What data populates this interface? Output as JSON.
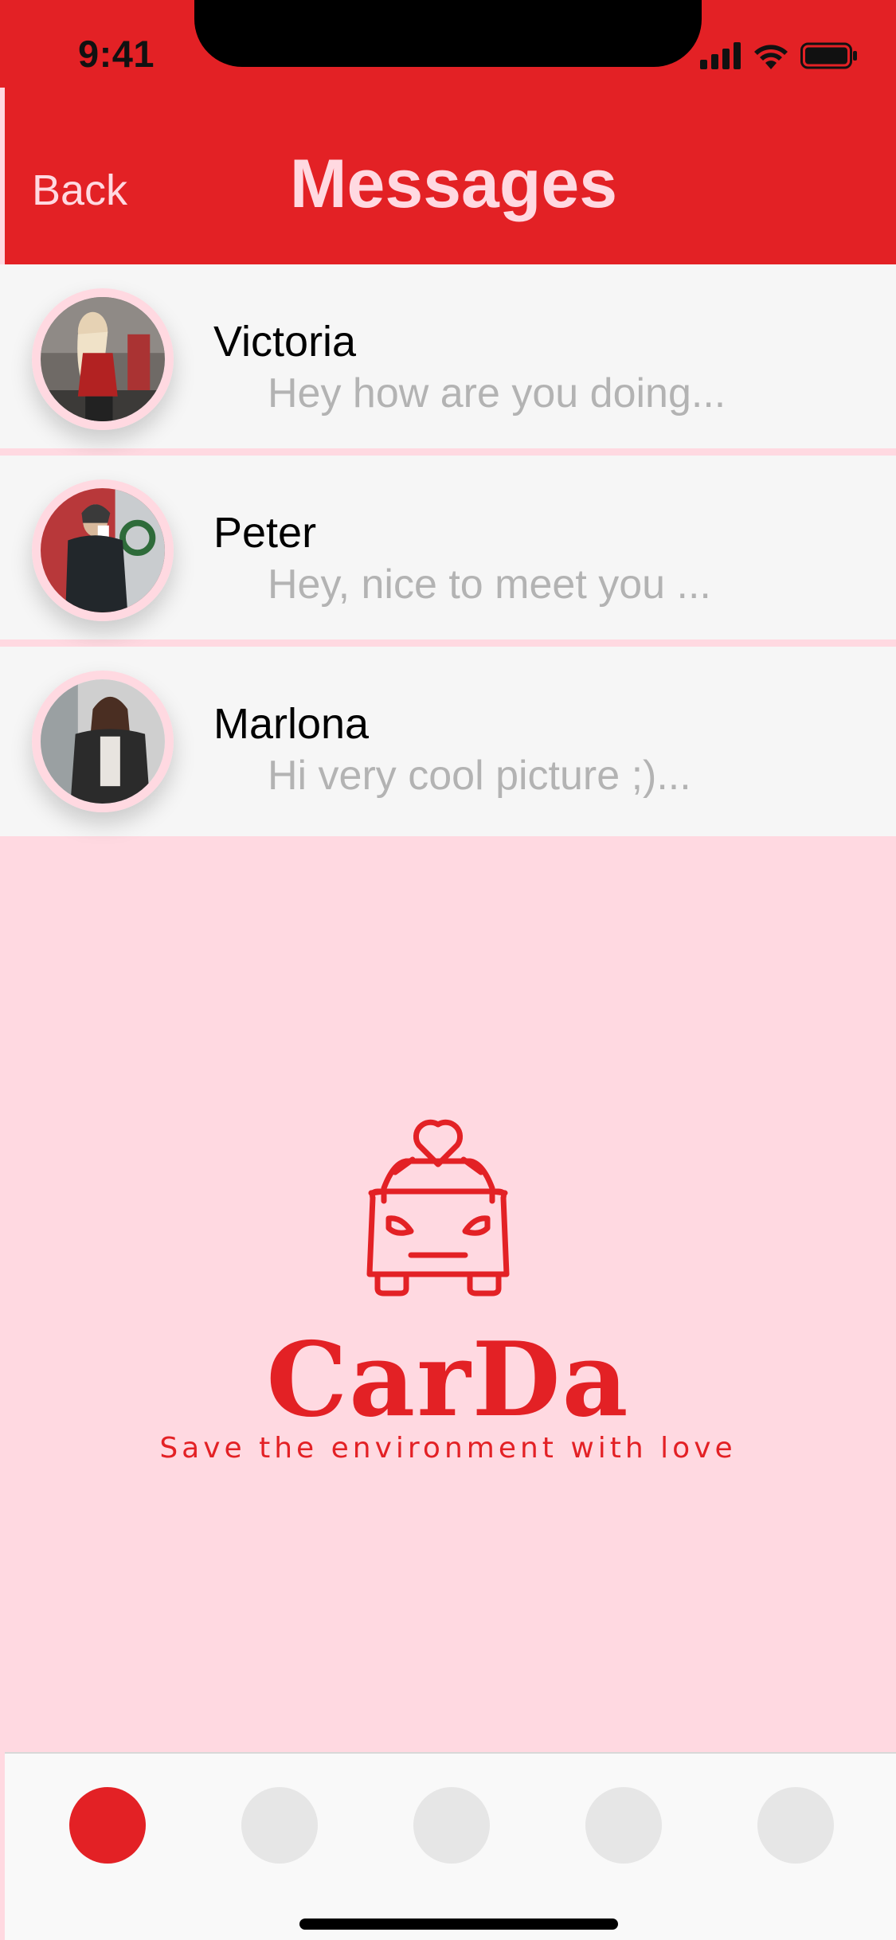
{
  "status_bar": {
    "time": "9:41"
  },
  "header": {
    "back_label": "Back",
    "title": "Messages"
  },
  "conversations": [
    {
      "name": "Victoria",
      "preview": "Hey how are you doing..."
    },
    {
      "name": "Peter",
      "preview": "Hey, nice to meet you ..."
    },
    {
      "name": "Marlona",
      "preview": "Hi very cool picture ;)..."
    }
  ],
  "brand": {
    "name": "CarDa",
    "tagline": "Save the environment with love"
  },
  "tab_bar": {
    "tabs": [
      {
        "active": true
      },
      {
        "active": false
      },
      {
        "active": false
      },
      {
        "active": false
      },
      {
        "active": false
      }
    ]
  },
  "colors": {
    "accent": "#e32125",
    "pink": "#ffd9e1",
    "list_bg": "#f6f6f6",
    "muted_text": "#b3b3b3"
  }
}
